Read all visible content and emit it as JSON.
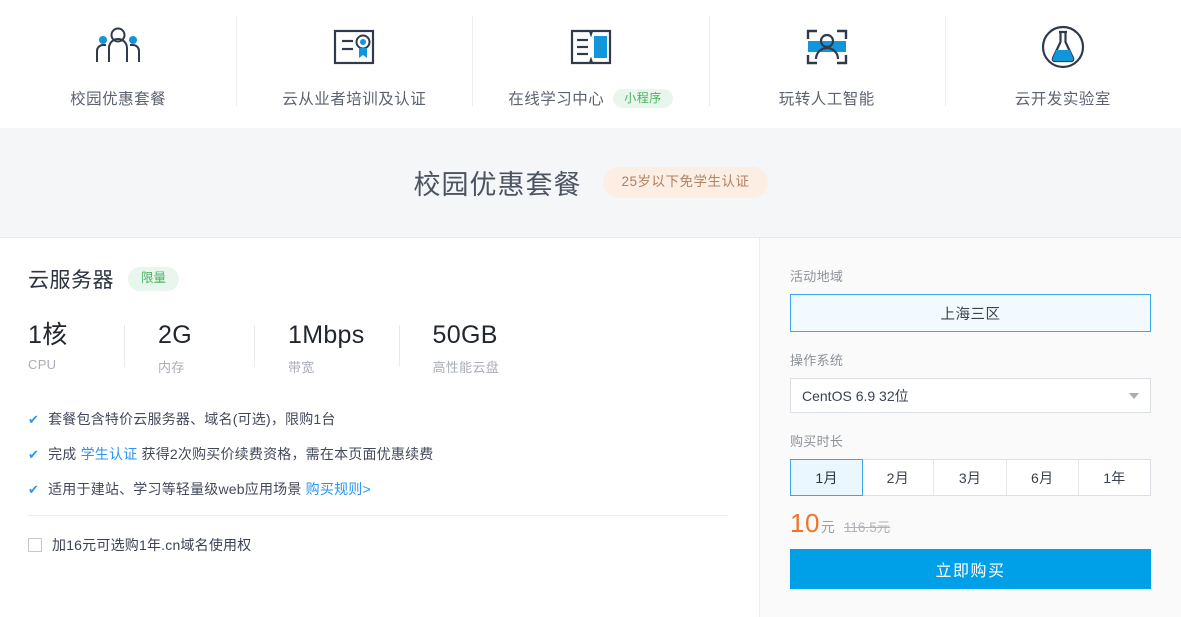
{
  "topnav": {
    "items": [
      {
        "label": "校园优惠套餐",
        "icon": "people-group-icon",
        "badge": null
      },
      {
        "label": "云从业者培训及认证",
        "icon": "certificate-icon",
        "badge": null
      },
      {
        "label": "在线学习中心",
        "icon": "open-book-icon",
        "badge": "小程序"
      },
      {
        "label": "玩转人工智能",
        "icon": "face-recognition-icon",
        "badge": null
      },
      {
        "label": "云开发实验室",
        "icon": "flask-circle-icon",
        "badge": null
      }
    ]
  },
  "title_band": {
    "title": "校园优惠套餐",
    "badge": "25岁以下免学生认证"
  },
  "product": {
    "name": "云服务器",
    "badge": "限量",
    "specs": [
      {
        "value": "1核",
        "label": "CPU"
      },
      {
        "value": "2G",
        "label": "内存"
      },
      {
        "value": "1Mbps",
        "label": "带宽"
      },
      {
        "value": "50GB",
        "label": "高性能云盘"
      }
    ],
    "features": [
      {
        "check": "✔",
        "parts": [
          {
            "text": "套餐包含特价云服务器、域名(可选)，限购1台",
            "link": false
          }
        ]
      },
      {
        "check": "✔",
        "parts": [
          {
            "text": "完成 ",
            "link": false
          },
          {
            "text": "学生认证",
            "link": true
          },
          {
            "text": " 获得2次购买价续费资格，需在本页面优惠续费",
            "link": false
          }
        ]
      },
      {
        "check": "✔",
        "parts": [
          {
            "text": "适用于建站、学习等轻量级web应用场景 ",
            "link": false
          },
          {
            "text": "购买规则>",
            "link": true
          }
        ]
      }
    ],
    "option_domain": {
      "label": "加16元可选购1年.cn域名使用权",
      "checked": false
    }
  },
  "config": {
    "region_label": "活动地域",
    "region_value": "上海三区",
    "os_label": "操作系统",
    "os_value": "CentOS 6.9 32位",
    "duration_label": "购买时长",
    "durations": [
      "1月",
      "2月",
      "3月",
      "6月",
      "1年"
    ],
    "duration_selected": "1月",
    "price_now": "10",
    "price_unit": "元",
    "price_old": "116.5元",
    "buy_label": "立即购买"
  },
  "colors": {
    "accent_blue": "#00a0e9",
    "link_blue": "#2a95f0",
    "price_orange": "#f2722b",
    "badge_green_bg": "#e8f6ec",
    "badge_green_fg": "#45b35d",
    "title_badge_bg": "#fdeee3",
    "title_badge_fg": "#b08163",
    "icon_dark": "#2f3b4c"
  }
}
